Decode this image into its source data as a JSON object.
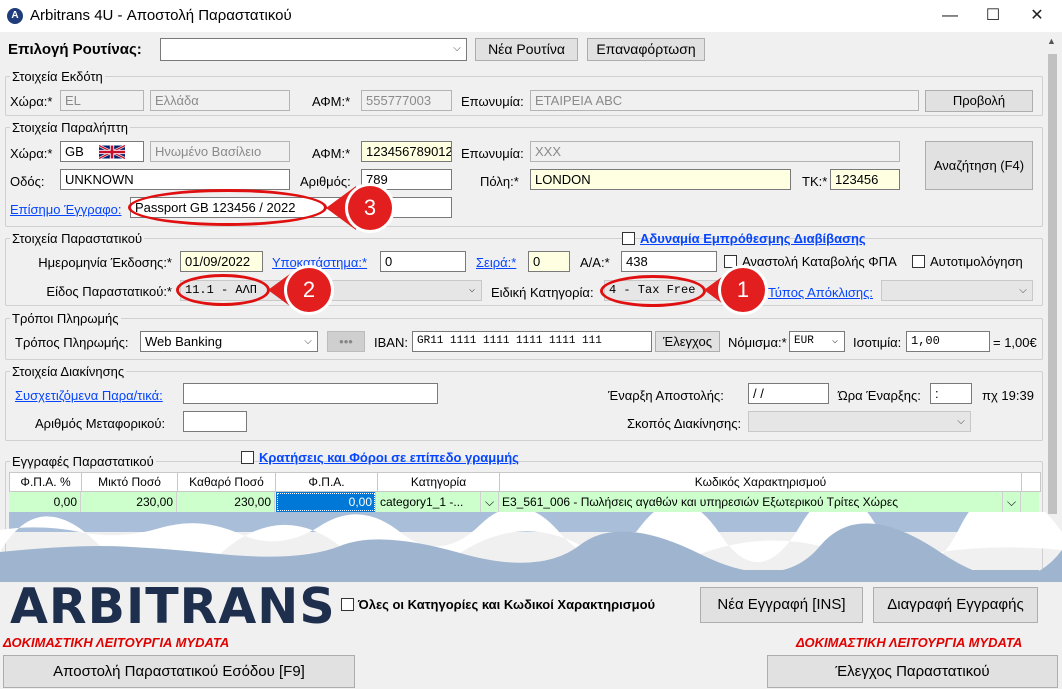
{
  "window": {
    "title": "Arbitrans 4U - Αποστολή Παραστατικού",
    "app_icon": "arbitrans-icon"
  },
  "routine": {
    "label": "Επιλογή Ρουτίνας:",
    "value": "",
    "new_button": "Νέα Ρουτίνα",
    "reload_button": "Επαναφόρτωση"
  },
  "issuer": {
    "title": "Στοιχεία Εκδότη",
    "country_label": "Χώρα:*",
    "country_code": "EL",
    "country_name": "Ελλάδα",
    "vat_label": "ΑΦΜ:*",
    "vat": "555777003",
    "name_label": "Επωνυμία:",
    "name": "ΕΤΑΙΡΕΙΑ ABC",
    "view_button": "Προβολή"
  },
  "recipient": {
    "title": "Στοιχεία Παραλήπτη",
    "country_label": "Χώρα:*",
    "country_code": "GB",
    "country_name": "Ηνωμένο Βασίλειο",
    "vat_label": "ΑΦΜ:*",
    "vat": "123456789012",
    "name_label": "Επωνυμία:",
    "name": "XXX",
    "street_label": "Οδός:",
    "street": "UNKNOWN",
    "number_label": "Αριθμός:",
    "number": "789",
    "city_label": "Πόλη:*",
    "city": "LONDON",
    "zip_label": "ΤΚ:*",
    "zip": "123456",
    "doc_label": "Επίσημο Έγγραφο:",
    "doc": "Passport GB 123456 / 2022",
    "search_button": "Αναζήτηση (F4)"
  },
  "document": {
    "title": "Στοιχεία Παραστατικού",
    "no_forward_label": "Αδυναμία Εμπρόθεσμης Διαβίβασης",
    "issue_date_label": "Ημερομηνία Έκδοσης:*",
    "issue_date": "01/09/2022",
    "branch_label": "Υποκατάστημα:*",
    "branch": "0",
    "series_label": "Σειρά:*",
    "series": "0",
    "aa_label": "Α/Α:*",
    "aa": "438",
    "vat_suspension_label": "Αναστολή Καταβολής ΦΠΑ",
    "self_billing_label": "Αυτοτιμολόγηση",
    "type_label": "Είδος Παραστατικού:*",
    "type": "11.1 - ΑΛΠ",
    "special_label": "Ειδική Κατηγορία:",
    "special": "4 - Tax Free",
    "deviation_label": "Τύπος Απόκλισης:",
    "deviation": ""
  },
  "payment": {
    "title": "Τρόποι Πληρωμής",
    "method_label": "Τρόπος Πληρωμής:",
    "method": "Web Banking",
    "more_button": "•••",
    "iban_label": "IBAN:",
    "iban": "GR11 1111 1111 1111 1111 111",
    "check_button": "Έλεγχος",
    "currency_label": "Νόμισμα:*",
    "currency": "EUR",
    "rate_label": "Ισοτιμία:",
    "rate": "1,00",
    "rate_suffix": "= 1,00€"
  },
  "movement": {
    "title": "Στοιχεία Διακίνησης",
    "related_label": "Συσχετιζόμενα Παρα/τικά:",
    "related": "",
    "vehicle_label": "Αριθμός Μεταφορικού:",
    "vehicle": "",
    "start_label": "Έναρξη Αποστολής:",
    "start": " / /",
    "time_label": "Ώρα Έναρξης:",
    "time": " :",
    "time_hint": "πχ 19:39",
    "purpose_label": "Σκοπός Διακίνησης:",
    "purpose": ""
  },
  "entries": {
    "title": "Εγγραφές Παραστατικού",
    "withholdings_label": "Κρατήσεις και Φόροι σε επίπεδο γραμμής",
    "columns": [
      "Φ.Π.Α. %",
      "Μικτό Ποσό",
      "Καθαρό Ποσό",
      "Φ.Π.Α.",
      "Κατηγορία",
      "Κωδικός Χαρακτηρισμού"
    ],
    "rows": [
      {
        "vat_pct": "0,00",
        "gross": "230,00",
        "net": "230,00",
        "vat": "0,00",
        "category": "category1_1  -...",
        "code": "E3_561_006 - Πωλήσεις αγαθών και υπηρεσιών Εξωτερικού Τρίτες Χώρες"
      }
    ]
  },
  "footer": {
    "logo": "ARBITRANS",
    "all_categories_label": "Όλες οι Κατηγορίες και Κωδικοί Χαρακτηρισμού",
    "new_entry_button": "Νέα Εγγραφή [INS]",
    "delete_entry_button": "Διαγραφή Εγγραφής",
    "test_mode_left": "ΔΟΚΙΜΑΣΤΙΚΗ ΛΕΙΤΟΥΡΓΙΑ MYDATA",
    "test_mode_right": "ΔΟΚΙΜΑΣΤΙΚΗ ΛΕΙΤΟΥΡΓΙΑ MYDATA",
    "send_button": "Αποστολή Παραστατικού Εσόδου [F9]",
    "check_button": "Έλεγχος Παραστατικού"
  },
  "annotations": [
    "1",
    "2",
    "3"
  ],
  "colors": {
    "annotation_red": "#e21e1e",
    "required_yellow": "#ffffe1",
    "row_green": "#ccffcc",
    "link_blue": "#0645ff",
    "test_mode_red": "#e00000",
    "logo_navy": "#1e2e4d"
  }
}
